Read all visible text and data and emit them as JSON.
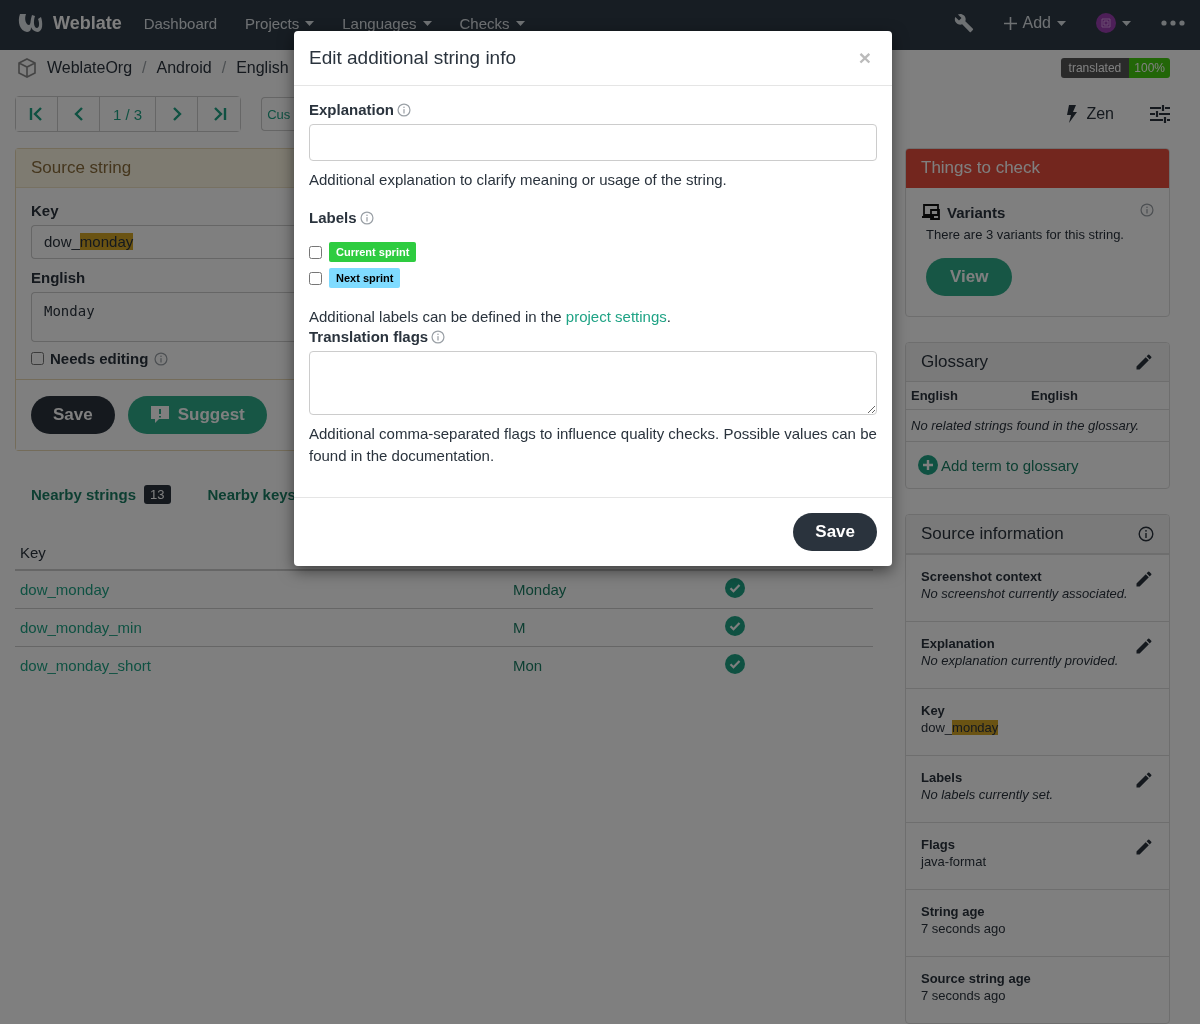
{
  "navbar": {
    "brand": "Weblate",
    "menu": [
      {
        "label": "Dashboard",
        "dropdown": false
      },
      {
        "label": "Projects",
        "dropdown": true
      },
      {
        "label": "Languages",
        "dropdown": true
      },
      {
        "label": "Checks",
        "dropdown": true
      }
    ],
    "add": "Add"
  },
  "breadcrumb": {
    "items": [
      "WeblateOrg",
      "Android",
      "English"
    ],
    "separator": "/"
  },
  "progress": {
    "label": "translated",
    "value": "100%"
  },
  "toolbar": {
    "position": "1 / 3",
    "search": "Cus",
    "zen": "Zen"
  },
  "source_card": {
    "title": "Source string",
    "key_label": "Key",
    "key": "dow_",
    "key_match": "monday",
    "language_label": "English",
    "text": "Monday",
    "needs_editing": {
      "label": "Needs editing",
      "checked": false
    },
    "buttons": [
      {
        "label": "Save",
        "kind": "dark"
      },
      {
        "label": "Suggest",
        "kind": "suggest"
      }
    ]
  },
  "tabs": [
    {
      "label": "Nearby strings",
      "count": "13"
    },
    {
      "label": "Nearby keys"
    }
  ],
  "table": {
    "columns": [
      "Key"
    ],
    "rows": [
      {
        "key": "dow_monday",
        "source": "Monday"
      },
      {
        "key": "dow_monday_min",
        "source": "M"
      },
      {
        "key": "dow_monday_short",
        "source": "Mon"
      }
    ]
  },
  "things_to_check": {
    "title": "Things to check",
    "checks": [
      {
        "name": "Variants",
        "text": "There are 3 variants for this string.",
        "button": "View"
      }
    ]
  },
  "glossary": {
    "title": "Glossary",
    "columns": [
      "English",
      "English"
    ],
    "empty": "No related strings found in the glossary.",
    "add": "Add term to glossary"
  },
  "source_info": {
    "title": "Source information",
    "rows": [
      {
        "label": "Screenshot context",
        "value": "No screenshot currently associated.",
        "kind": "note",
        "editable": true
      },
      {
        "label": "Explanation",
        "value": "No explanation currently provided.",
        "kind": "note",
        "editable": true
      },
      {
        "label": "Key",
        "value": "dow_",
        "match": "monday",
        "kind": "key",
        "editable": false
      },
      {
        "label": "Labels",
        "value": "No labels currently set.",
        "kind": "note",
        "editable": true
      },
      {
        "label": "Flags",
        "value": "java-format",
        "kind": "plain",
        "editable": true
      },
      {
        "label": "String age",
        "value": "7 seconds ago",
        "kind": "plain",
        "editable": false
      },
      {
        "label": "Source string age",
        "value": "7 seconds ago",
        "kind": "plain",
        "editable": false
      }
    ]
  },
  "modal": {
    "title": "Edit additional string info",
    "close": "×",
    "explanation": {
      "label": "Explanation",
      "help": "Additional explanation to clarify meaning or usage of the string."
    },
    "labels": {
      "label": "Labels",
      "items": [
        {
          "name": "Current sprint",
          "color": "#2ecc40",
          "checked": false
        },
        {
          "name": "Next sprint",
          "color": "#7fdbff",
          "checked": false
        }
      ],
      "help_before": "Additional labels can be defined in the ",
      "help_link": "project settings",
      "help_after": "."
    },
    "flags": {
      "label": "Translation flags",
      "help": "Additional comma-separated flags to influence quality checks. Possible values can be found in the documentation."
    },
    "save": "Save"
  }
}
